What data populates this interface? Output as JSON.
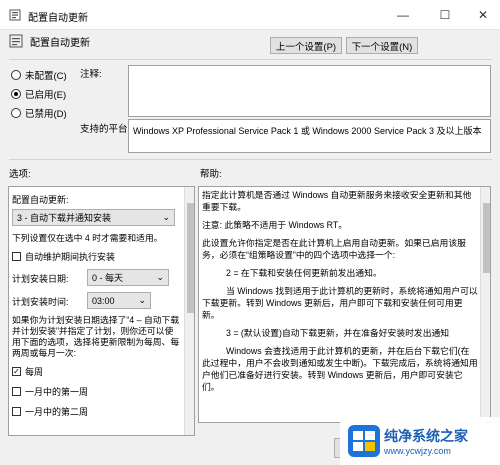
{
  "window": {
    "title": "配置自动更新",
    "minimize": "—",
    "maximize": "☐",
    "close": "✕"
  },
  "header": {
    "policy_name": "配置自动更新",
    "prev_button": "上一个设置(P)",
    "next_button": "下一个设置(N)"
  },
  "state": {
    "options": [
      {
        "label": "未配置(C)",
        "selected": false
      },
      {
        "label": "已启用(E)",
        "selected": true
      },
      {
        "label": "已禁用(D)",
        "selected": false
      }
    ]
  },
  "comment": {
    "label": "注释:",
    "value": ""
  },
  "supported": {
    "label": "支持的平台:",
    "value": "Windows XP Professional Service Pack 1 或 Windows 2000 Service Pack 3 及以上版本"
  },
  "options_panel": {
    "label": "选项:",
    "configure_label": "配置自动更新:",
    "configure_value": "3 - 自动下载并通知安装",
    "note": "下列设置仅在选中 4 时才需要和适用。",
    "auto_maintenance": "自动维护期间执行安装",
    "schedule_day_label": "计划安装日期:",
    "schedule_day_value": "0 - 每天",
    "schedule_time_label": "计划安装时间:",
    "schedule_time_value": "03:00",
    "description": "如果你为计划安装日期选择了“4 – 自动下载并计划安装”并指定了计划，则你还可以使用下面的选项，选择将更新限制为每周、每两周或每月一次:",
    "weekly_label": "每周",
    "weekly_checked": true,
    "first_week_label": "一月中的第一周",
    "second_week_label": "一月中的第二周"
  },
  "help_panel": {
    "label": "帮助:",
    "paragraphs": [
      "指定此计算机是否通过 Windows 自动更新服务来接收安全更新和其他重要下载。",
      "注意: 此策略不适用于 Windows RT。",
      "此设置允许你指定是否在此计算机上启用自动更新。如果已启用该服务，必须在“组策略设置”中的四个选项中选择一个:",
      "2 = 在下载和安装任何更新前发出通知。",
      "当 Windows 找到适用于此计算机的更新时，系统将通知用户可以下载更新。转到 Windows 更新后，用户即可下载和安装任何可用更新。",
      "3 = (默认设置)自动下载更新，并在准备好安装时发出通知",
      "Windows 会查找适用于此计算机的更新，并在后台下载它们(在此过程中，用户不会收到通知或发生中断)。下载完成后，系统将通知用户他们已准备好进行安装。转到 Windows 更新后，用户即可安装它们。"
    ]
  },
  "footer": {
    "ok_button": "确定"
  },
  "watermark": {
    "title": "纯净系统之家",
    "url": "www.ycwjzy.com"
  }
}
